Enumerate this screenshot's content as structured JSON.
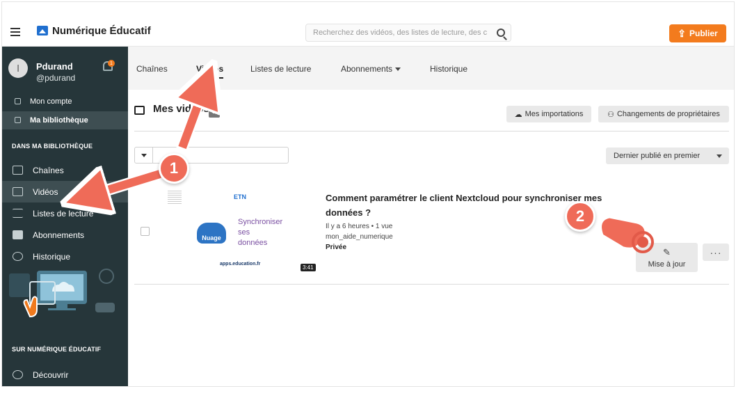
{
  "header": {
    "brand": "Numérique Éducatif",
    "search_placeholder": "Recherchez des vidéos, des listes de lecture, des chaîne",
    "publish_label": "Publier"
  },
  "user": {
    "avatar_letter": "l",
    "name": "Pdurand",
    "handle": "@pdurand",
    "notifications": "1"
  },
  "sidebar": {
    "account_items": [
      {
        "label": "Mon compte"
      },
      {
        "label": "Ma bibliothèque"
      }
    ],
    "section_library": "DANS MA BIBLIOTHÈQUE",
    "library_items": [
      {
        "label": "Chaînes"
      },
      {
        "label": "Vidéos"
      },
      {
        "label": "Listes de lecture"
      },
      {
        "label": "Abonnements"
      },
      {
        "label": "Historique"
      }
    ],
    "section_site": "SUR NUMÉRIQUE ÉDUCATIF",
    "site_items": [
      {
        "label": "Découvrir"
      }
    ]
  },
  "tabs": [
    {
      "label": "Chaînes"
    },
    {
      "label": "Vidéos"
    },
    {
      "label": "Listes de lecture"
    },
    {
      "label": "Abonnements"
    },
    {
      "label": "Historique"
    }
  ],
  "main": {
    "title": "Mes vidéos",
    "count": "1",
    "imports_label": "Mes importations",
    "ownership_label": "Changements de propriétaires",
    "sort_label": "Dernier publié en premier"
  },
  "video": {
    "title": "Comment paramétrer le client Nextcloud pour synchroniser mes données ?",
    "meta": "Il y a 6 heures • 1 vue",
    "channel": "mon_aide_numerique",
    "privacy": "Privée",
    "duration": "3:41",
    "thumb_etn": "ETN",
    "thumb_cloud": "Nuage",
    "thumb_sync_lines": [
      "Synchroniser",
      "ses",
      "données"
    ],
    "thumb_apps": "apps.education.fr",
    "update_label": "Mise à jour",
    "more_label": "···"
  },
  "steps": [
    "1",
    "2"
  ],
  "colors": {
    "accent": "#f37b1d",
    "sidebar_bg": "#26363a",
    "sidebar_active": "#3e4e52",
    "annotation": "#ef6b58"
  }
}
